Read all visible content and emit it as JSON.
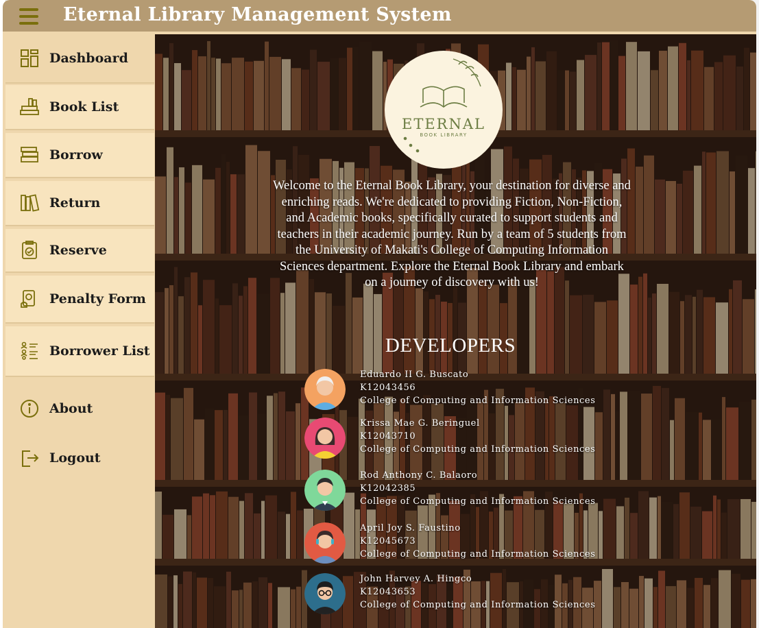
{
  "app": {
    "title": "Eternal Library Management System",
    "colors": {
      "titlebar": "#b59b73",
      "sidebar": "#efd7ad",
      "nav_item": "#f8e4be",
      "icon": "#7a6f0c"
    }
  },
  "sidebar": {
    "items": [
      {
        "label": "Dashboard",
        "icon": "dashboard-grid-icon"
      },
      {
        "label": "Book List",
        "icon": "book-stack-icon"
      },
      {
        "label": "Borrow",
        "icon": "borrow-books-icon"
      },
      {
        "label": "Return",
        "icon": "return-books-icon"
      },
      {
        "label": "Reserve",
        "icon": "reserve-clipboard-icon"
      },
      {
        "label": "Penalty Form",
        "icon": "penalty-form-icon"
      },
      {
        "label": "Borrower List",
        "icon": "borrower-list-icon"
      },
      {
        "label": "About",
        "icon": "info-icon"
      },
      {
        "label": "Logout",
        "icon": "logout-icon"
      }
    ]
  },
  "about": {
    "logo_text": "ETERNAL",
    "logo_subtext": "BOOK LIBRARY",
    "intro": "Welcome to the Eternal Book Library, your destination for diverse and enriching reads. We're dedicated to providing Fiction, Non-Fiction, and Academic books, specifically curated to support students and teachers in their academic journey. Run by a team of 5 students from the University of Makati's College of Computing Information Sciences department. Explore the Eternal Book Library and embark on a journey of discovery with us!",
    "developers_heading": "DEVELOPERS",
    "developers": [
      {
        "name": "Eduardo II G. Buscato",
        "id": "K12043456",
        "college": "College of Computing and Information Sciences"
      },
      {
        "name": "Krissa Mae G. Beringuel",
        "id": "K12043710",
        "college": "College of Computing and Information Sciences"
      },
      {
        "name": "Rod Anthony C. Balaoro",
        "id": "K12042385",
        "college": "College of Computing and Information Sciences"
      },
      {
        "name": "April Joy S. Faustino",
        "id": "K12045673",
        "college": "College of Computing and Information Sciences"
      },
      {
        "name": "John Harvey A. Hingco",
        "id": "K12043653",
        "college": "College of Computing and Information Sciences"
      }
    ]
  }
}
